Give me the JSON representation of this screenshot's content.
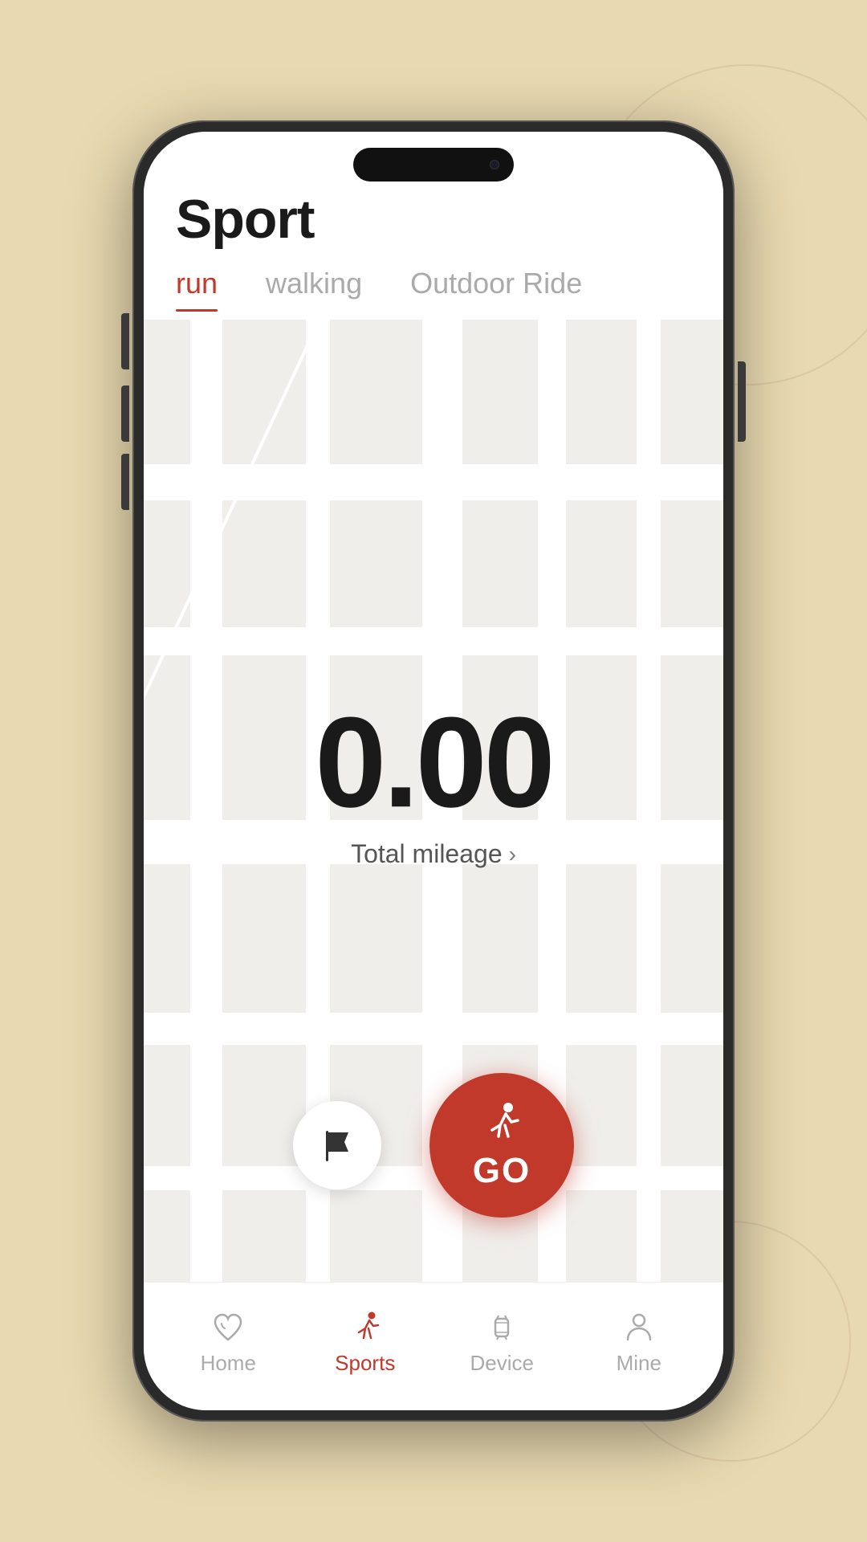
{
  "background_color": "#e8d9b0",
  "page": {
    "title": "Sport"
  },
  "tabs": [
    {
      "id": "run",
      "label": "run",
      "active": true
    },
    {
      "id": "walking",
      "label": "walking",
      "active": false
    },
    {
      "id": "outdoor_ride",
      "label": "Outdoor Ride",
      "active": false
    }
  ],
  "mileage": {
    "value": "0.00",
    "label": "Total mileage"
  },
  "buttons": {
    "flag_label": "flag",
    "go_label": "GO"
  },
  "bottom_nav": [
    {
      "id": "home",
      "label": "Home",
      "icon": "heart",
      "active": false
    },
    {
      "id": "sports",
      "label": "Sports",
      "icon": "run",
      "active": true
    },
    {
      "id": "device",
      "label": "Device",
      "icon": "watch",
      "active": false
    },
    {
      "id": "mine",
      "label": "Mine",
      "icon": "person",
      "active": false
    }
  ]
}
